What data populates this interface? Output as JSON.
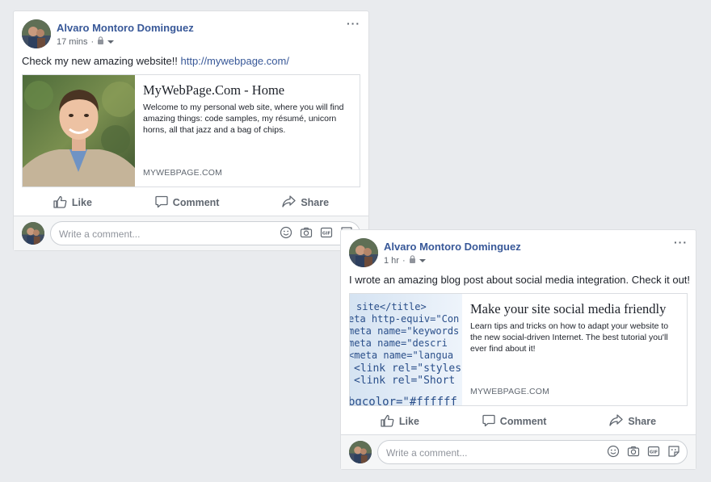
{
  "posts": [
    {
      "author": "Alvaro Montoro Dominguez",
      "time": "17 mins",
      "text": "Check my new amazing website!! ",
      "link": "http://mywebpage.com/",
      "card": {
        "title": "MyWebPage.Com - Home",
        "description": "Welcome to my personal web site, where you will find amazing things: code samples, my résumé, unicorn horns, all that jazz and a bag of chips.",
        "domain": "MYWEBPAGE.COM"
      }
    },
    {
      "author": "Alvaro Montoro Dominguez",
      "time": "1 hr",
      "text": "I wrote an amazing blog post about social media integration. Check it out!",
      "link": "",
      "card": {
        "title": "Make your site social media friendly",
        "description": "Learn tips and tricks on how to adapt your website to the new social-driven Internet. The best tutorial you'll ever find about it!",
        "domain": "MYWEBPAGE.COM",
        "code_lines": [
          "site</title>",
          "eta http-equiv=\"Con",
          "meta name=\"keywords",
          "meta name=\"descri",
          "<meta name=\"langua",
          "<link rel=\"styles",
          "<link rel=\"Short",
          "",
          "bgcolor=\"#ffffff"
        ]
      }
    }
  ],
  "actions": {
    "like": "Like",
    "comment": "Comment",
    "share": "Share"
  },
  "comment_placeholder": "Write a comment...",
  "separator": "·",
  "more": "···",
  "colors": {
    "link": "#385898",
    "meta": "#606770",
    "background": "#e9ebee"
  },
  "icons": [
    "privacy-lock-icon",
    "audience-dropdown-icon",
    "like-icon",
    "comment-icon",
    "share-icon",
    "emoji-icon",
    "camera-icon",
    "gif-icon",
    "sticker-icon"
  ]
}
